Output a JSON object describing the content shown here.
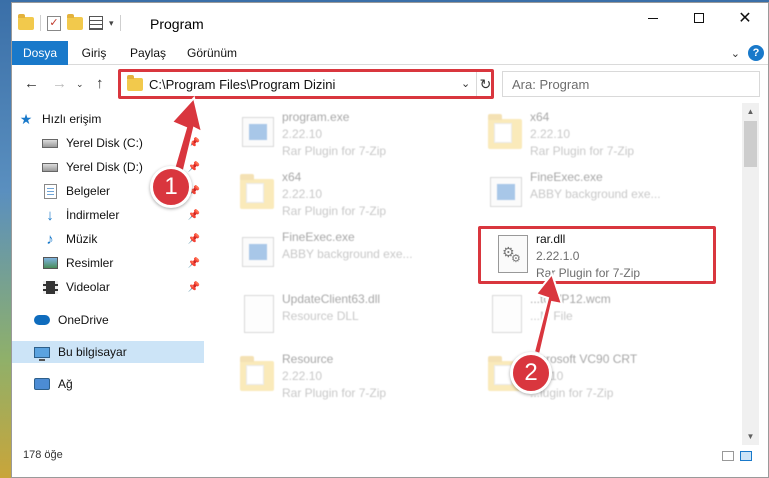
{
  "window": {
    "title": "Program",
    "minimize_label": "",
    "maximize_label": "",
    "close_label": "✕"
  },
  "ribbon": {
    "tabs": [
      "Dosya",
      "Giriş",
      "Paylaş",
      "Görünüm"
    ],
    "help": "?"
  },
  "address": {
    "path": "C:\\Program Files\\Program Dizini",
    "search_placeholder": "Ara: Program"
  },
  "sidebar": {
    "quick_access": "Hızlı erişim",
    "items": [
      "Yerel Disk (C:)",
      "Yerel Disk (D:)",
      "Belgeler",
      "İndirmeler",
      "Müzik",
      "Resimler",
      "Videolar"
    ],
    "onedrive": "OneDrive",
    "this_pc": "Bu bilgisayar",
    "network": "Ağ"
  },
  "files": [
    {
      "name": "program.exe",
      "line2": "2.22.10",
      "line3": "Rar Plugin for 7-Zip",
      "icon": "exe-icon"
    },
    {
      "name": "x64",
      "line2": "2.22.10",
      "line3": "Rar Plugin for 7-Zip",
      "icon": "folder-icon"
    },
    {
      "name": "x64",
      "line2": "2.22.10",
      "line3": "Rar Plugin for 7-Zip",
      "icon": "folder-icon"
    },
    {
      "name": "FineExec.exe",
      "line2": "ABBY background exe...",
      "line3": "",
      "icon": "exe-icon"
    },
    {
      "name": "FineExec.exe",
      "line2": "ABBY background exe...",
      "line3": "",
      "icon": "exe-icon"
    },
    {
      "name": "rar.dll",
      "line2": "2.22.1.0",
      "line3": "Rar Plugin for 7-Zip",
      "icon": "dll-icon"
    },
    {
      "name": "UpdateClient63.dll",
      "line2": "Resource DLL",
      "line3": "",
      "icon": "dll-icon"
    },
    {
      "name": "...toWP12.wcm",
      "line2": "...M File",
      "line3": "",
      "icon": "file-icon"
    },
    {
      "name": "Resource",
      "line2": "2.22.10",
      "line3": "Rar Plugin for 7-Zip",
      "icon": "folder-icon"
    },
    {
      "name": "...crosoft VC90 CRT",
      "line2": "...2.10",
      "line3": "...lugin for 7-Zip",
      "icon": "folder-icon"
    }
  ],
  "status": {
    "item_count": "178 öğe"
  },
  "annotations": {
    "badge1": "1",
    "badge2": "2",
    "highlight_color": "#d9363e"
  },
  "colors": {
    "accent": "#1979ca",
    "selected": "#cce4f7"
  }
}
